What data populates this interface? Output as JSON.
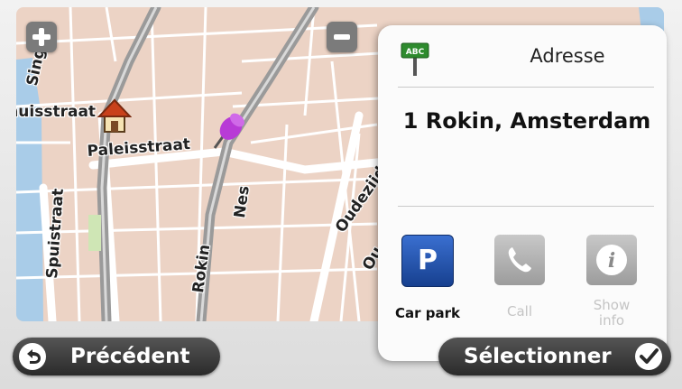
{
  "map": {
    "streets": [
      "Singel",
      "Raadhuisstraat",
      "Paleisstraat",
      "Spuistraat",
      "Rokin",
      "Nes",
      "Oudezijds",
      "Ou"
    ],
    "marker_icon": "pin-icon",
    "home_icon": "home-icon"
  },
  "zoom": {
    "in_icon": "plus-icon",
    "out_icon": "minus-icon"
  },
  "panel": {
    "title": "Adresse",
    "title_icon": "address-sign-icon",
    "address": "1 Rokin, Amsterdam",
    "actions": [
      {
        "label": "Car park",
        "icon": "parking-icon",
        "enabled": true,
        "color": "#1f4fa8"
      },
      {
        "label": "Call",
        "icon": "phone-icon",
        "enabled": false
      },
      {
        "label": "Show info",
        "icon": "info-icon",
        "enabled": false
      }
    ]
  },
  "buttons": {
    "back_label": "Précédent",
    "select_label": "Sélectionner"
  },
  "colors": {
    "map_bg": "#ecd3c5",
    "road_main": "#9a9a9a",
    "water": "#9ec6e6",
    "accent": "#1f4fa8"
  }
}
